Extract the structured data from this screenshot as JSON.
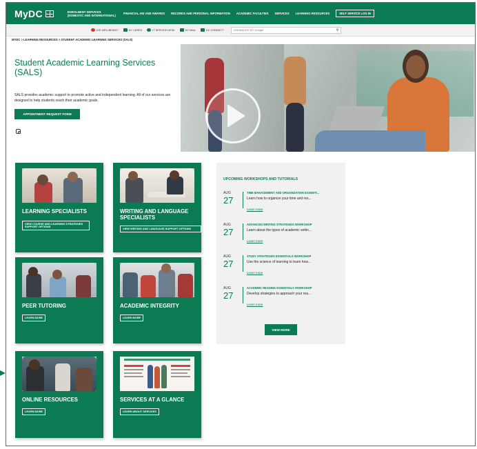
{
  "brand": {
    "logo": "MyDC"
  },
  "nav": {
    "items": [
      {
        "label": "Enrolment Services (Domestic and International)"
      },
      {
        "label": "Financial Aid and Awards"
      },
      {
        "label": "Records and Personal Information"
      },
      {
        "label": "Academic Faculties"
      },
      {
        "label": "Services"
      },
      {
        "label": "Learning Resources"
      }
    ],
    "login": "Self Service Log In"
  },
  "utility": {
    "items": [
      {
        "label": "Dis Wellbeing?",
        "icon": "life-ring-icon"
      },
      {
        "label": "DC Cares",
        "icon": "chat-icon"
      },
      {
        "label": "IT Service Desk",
        "icon": "gear-icon"
      },
      {
        "label": "DC Mail",
        "icon": "mail-icon"
      },
      {
        "label": "DC Connect",
        "icon": "laptop-icon"
      }
    ],
    "search_placeholder": "ENHANCED BY Google"
  },
  "breadcrumb": "MyDC > Learning Resources > Student Academic Learning Services (SALS)",
  "hero": {
    "title": "Student Academic Learning Services (SALS)",
    "description": "SALS provides academic support to promote active and independent learning. All of our services are designed to help students reach their academic goals.",
    "button": "Appointment Request Form"
  },
  "cards": [
    {
      "title": "Learning Specialists",
      "button": "View Course and Learning Strategies Support Options"
    },
    {
      "title": "Writing and Language Specialists",
      "button": "View Writing and Language Support Options"
    },
    {
      "title": "Peer Tutoring",
      "button": "Learn More"
    },
    {
      "title": "Academic Integrity",
      "button": "Learn More"
    },
    {
      "title": "Online Resources",
      "button": "Learn More"
    },
    {
      "title": "Services at a Glance",
      "button": "Learn About Services"
    }
  ],
  "workshops": {
    "header": "Upcoming Workshops and Tutorials",
    "items": [
      {
        "month": "AUG",
        "day": "27",
        "title": "Time Management and Organization Essenti...",
        "desc": "Learn how to organize your time and res...",
        "link": "Learn more"
      },
      {
        "month": "AUG",
        "day": "27",
        "title": "Advanced Writing Strategies Workshop",
        "desc": "Learn about the types of academic writin...",
        "link": "Learn more"
      },
      {
        "month": "AUG",
        "day": "27",
        "title": "Study Strategies Essentials Workshop",
        "desc": "Use the science of learning to learn how...",
        "link": "Learn more"
      },
      {
        "month": "AUG",
        "day": "27",
        "title": "Academic Reading Essentials Workshop",
        "desc": "Develop strategies to approach your rea...",
        "link": "Learn more"
      }
    ],
    "button": "View More"
  },
  "colors": {
    "brand": "#0c7a52",
    "panel": "#f1f1f1"
  }
}
